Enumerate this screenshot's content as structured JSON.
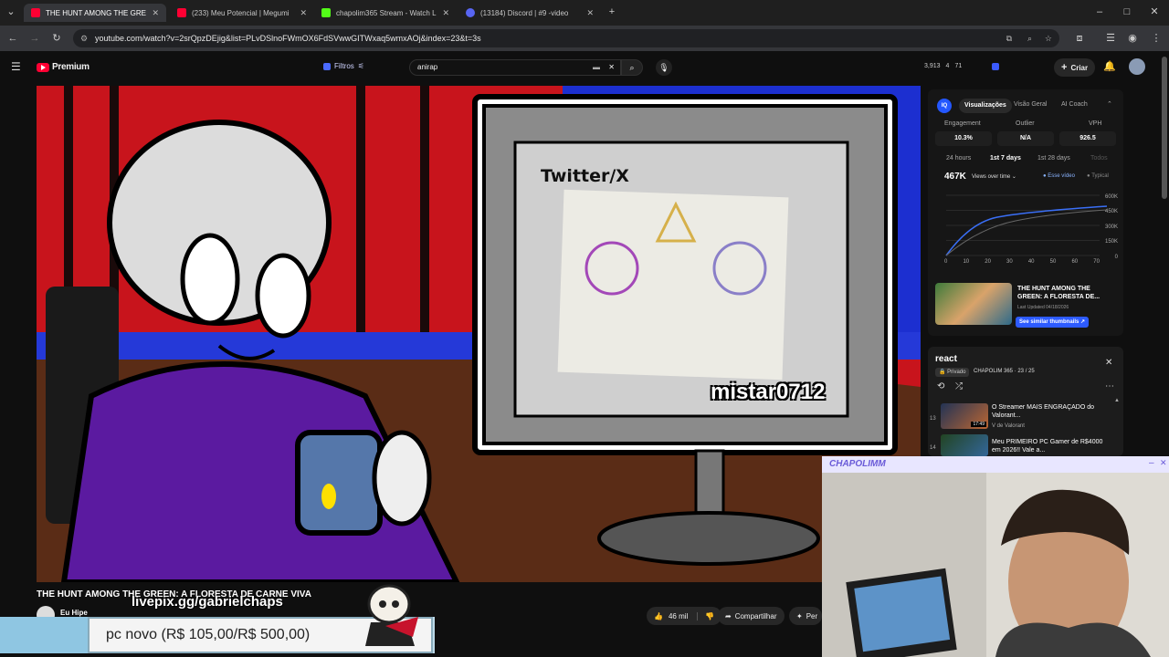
{
  "browser": {
    "tabs": [
      {
        "label": "THE HUNT AMONG THE GREE",
        "active": true,
        "favicon_color": "#ff0033"
      },
      {
        "label": "(233) Meu Potencial | Megumi",
        "active": false,
        "favicon_color": "#ff0033"
      },
      {
        "label": "chapolim365 Stream - Watch L",
        "active": false,
        "favicon_color": "#53fc18"
      },
      {
        "label": "(13184) Discord | #9 -video",
        "active": false,
        "favicon_color": "#5865f2"
      }
    ],
    "new_tab": "+",
    "url": "youtube.com/watch?v=2srQpzDEjig&list=PLvDSlnoFWmOX6FdSVwwGITWxaq5wmxAOj&index=23&t=3s"
  },
  "youtube_header": {
    "logo": "Premium",
    "filters_label": "Filtros",
    "search_value": "anirap",
    "counts": [
      "3,913",
      "4",
      "71"
    ],
    "create_label": "Criar"
  },
  "video": {
    "twitter_text": "Twitter/X",
    "credit_text": "mistar0712"
  },
  "analytics": {
    "tabs": [
      "Visualizações",
      "Visão Geral",
      "AI Coach"
    ],
    "metrics": [
      {
        "label": "Engagement",
        "value": "10.3%"
      },
      {
        "label": "Outlier",
        "value": "N/A"
      },
      {
        "label": "VPH",
        "value": "926.5"
      }
    ],
    "ranges": [
      "24 hours",
      "1st 7 days",
      "1st 28 days",
      "Todos"
    ],
    "views": "467K",
    "views_dropdown": "Views over time",
    "legend": [
      "Esse vídeo",
      "Typical"
    ],
    "y_ticks": [
      "600K",
      "450K",
      "300K",
      "150K",
      "0"
    ],
    "x_ticks": [
      "0",
      "10",
      "20",
      "30",
      "40",
      "50",
      "60",
      "70"
    ],
    "card_title": "THE HUNT AMONG THE GREEN: A FLORESTA DE...",
    "card_updated": "Last Updated 04/18/2026",
    "card_button": "See similar thumbnails"
  },
  "playlist": {
    "title": "react",
    "privacy": "Privado",
    "owner": "CHAPOLIM 365 · 23 / 25",
    "items": [
      {
        "num": "13",
        "title": "O Streamer MAIS ENGRAÇADO do Valorant...",
        "channel": "V de Valorant",
        "duration": "17:49"
      },
      {
        "num": "14",
        "title": "Meu PRIMEIRO PC Gamer de R$4000 em 2026!! Vale a...",
        "channel": "",
        "duration": ""
      }
    ]
  },
  "webcam": {
    "title": "CHAPOLIMM"
  },
  "below_video": {
    "title": "THE HUNT AMONG THE GREEN: A FLORESTA DE CARNE VIVA",
    "channel": "Eu Hipe",
    "likes": "46 mil",
    "share": "Compartilhar",
    "more": "Per"
  },
  "overlay": {
    "livepix": "livepix.gg/gabrielchaps",
    "goal": "pc novo (R$ 105,00/R$ 500,00)",
    "goal_progress_fraction": 0.21
  },
  "colors": {
    "yt_red": "#ff0033",
    "accent_blue": "#3ea6ff",
    "webcam_title": "#6a5bd8"
  }
}
